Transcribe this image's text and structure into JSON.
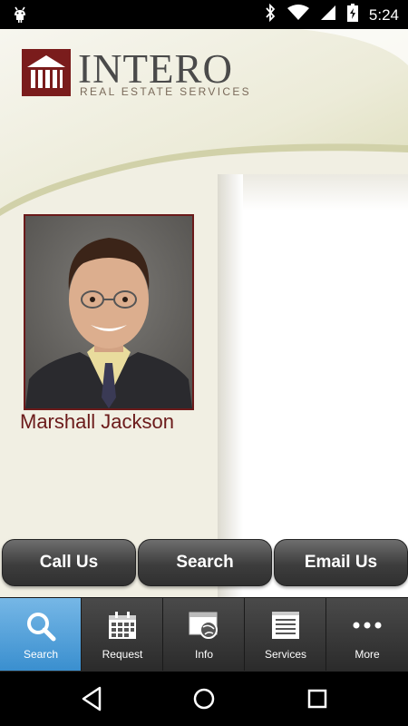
{
  "status_bar": {
    "time": "5:24",
    "icons": [
      "android-debug-icon",
      "bluetooth-icon",
      "wifi-icon",
      "signal-icon",
      "battery-icon"
    ]
  },
  "brand": {
    "name": "INTERO",
    "tagline": "REAL ESTATE SERVICES",
    "colors": {
      "maroon": "#7a1c1c",
      "accent_blue": "#4a9ddb",
      "button_dark": "#3d3d3d"
    }
  },
  "agent": {
    "name": "Marshall Jackson",
    "photo_icon": "agent-photo"
  },
  "actions": [
    {
      "label": "Call Us"
    },
    {
      "label": "Search"
    },
    {
      "label": "Email Us"
    }
  ],
  "tabs": [
    {
      "label": "Search",
      "icon": "search-icon",
      "active": true
    },
    {
      "label": "Request",
      "icon": "calendar-icon",
      "active": false
    },
    {
      "label": "Info",
      "icon": "info-globe-icon",
      "active": false
    },
    {
      "label": "Services",
      "icon": "document-list-icon",
      "active": false
    },
    {
      "label": "More",
      "icon": "more-dots-icon",
      "active": false
    }
  ],
  "system_nav": [
    "back-icon",
    "home-icon",
    "recents-icon"
  ]
}
